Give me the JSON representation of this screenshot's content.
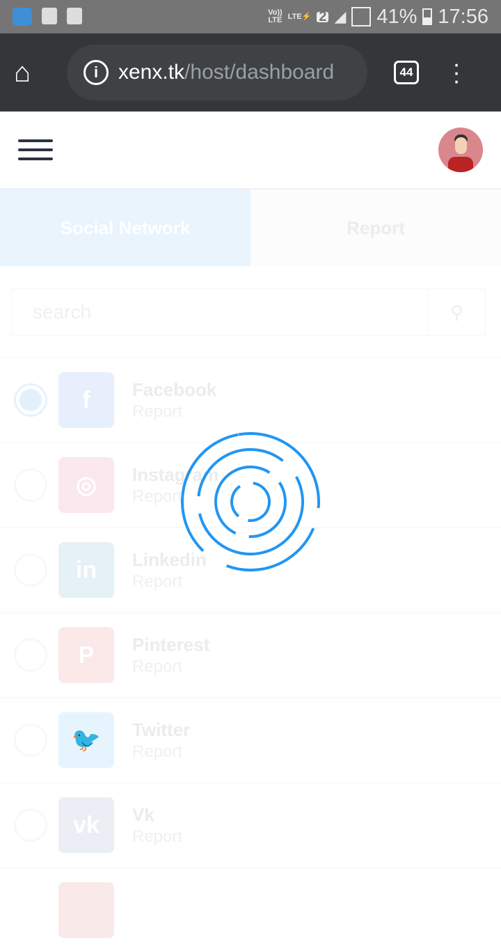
{
  "status_bar": {
    "battery": "41%",
    "time": "17:56",
    "volte": "Vo))",
    "lte": "LTE",
    "sim": "2"
  },
  "browser": {
    "url_host": "xenx.tk",
    "url_path": "/host/dashboard",
    "tab_count": "44"
  },
  "tabs": [
    {
      "label": "Social Network"
    },
    {
      "label": "Report"
    }
  ],
  "search": {
    "placeholder": "search"
  },
  "items": [
    {
      "name": "Facebook",
      "sub": "Report",
      "color": "#e8effc",
      "glyph": "f",
      "selected": true
    },
    {
      "name": "Instagram",
      "sub": "Report",
      "color": "#fbe8ef",
      "glyph": "◎"
    },
    {
      "name": "Linkedin",
      "sub": "Report",
      "color": "#e6f0f7",
      "glyph": "in"
    },
    {
      "name": "Pinterest",
      "sub": "Report",
      "color": "#fbe8e8",
      "glyph": "P"
    },
    {
      "name": "Twitter",
      "sub": "Report",
      "color": "#e6f5fd",
      "glyph": "🐦"
    },
    {
      "name": "Vk",
      "sub": "Report",
      "color": "#ebeef4",
      "glyph": "vk"
    }
  ],
  "colors": {
    "loader": "#2196f3"
  }
}
